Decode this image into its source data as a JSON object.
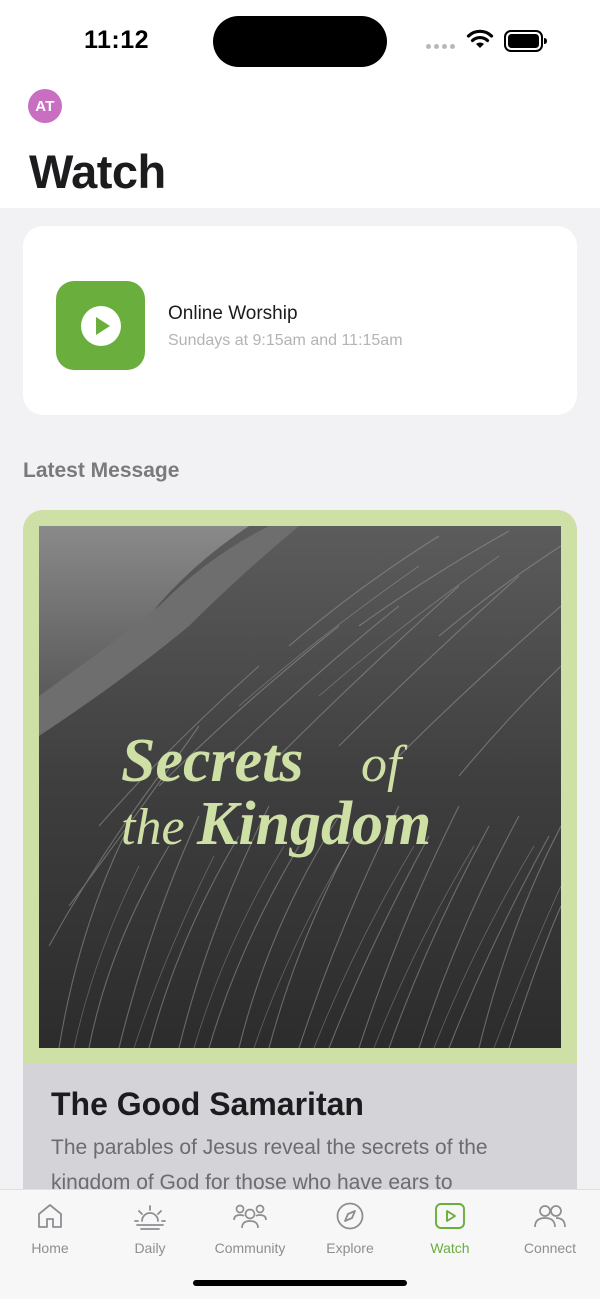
{
  "status_bar": {
    "time": "11:12"
  },
  "header": {
    "avatar_initials": "AT",
    "title": "Watch"
  },
  "worship_card": {
    "title": "Online Worship",
    "subtitle": "Sundays at 9:15am and 11:15am",
    "icon": "play-circle-icon",
    "accent": "#6aae3e"
  },
  "latest": {
    "section_label": "Latest Message",
    "artwork_text": {
      "line1_word1": "Secrets",
      "line1_word2": "of",
      "line2_word1": "the",
      "line2_word2": "Kingdom"
    },
    "artwork_colors": {
      "frame": "#cfe0a6",
      "text": "#cfe0a6"
    },
    "title": "The Good Samaritan",
    "description": "The parables of Jesus reveal the secrets of the kingdom of God for those who have ears to"
  },
  "tabs": [
    {
      "label": "Home",
      "icon": "home-icon",
      "active": false
    },
    {
      "label": "Daily",
      "icon": "sunrise-icon",
      "active": false
    },
    {
      "label": "Community",
      "icon": "people-icon",
      "active": false
    },
    {
      "label": "Explore",
      "icon": "compass-icon",
      "active": false
    },
    {
      "label": "Watch",
      "icon": "play-square-icon",
      "active": true
    },
    {
      "label": "Connect",
      "icon": "connect-people-icon",
      "active": false
    }
  ],
  "colors": {
    "active_tab": "#6aae3e",
    "inactive_tab": "#8e8e93"
  }
}
